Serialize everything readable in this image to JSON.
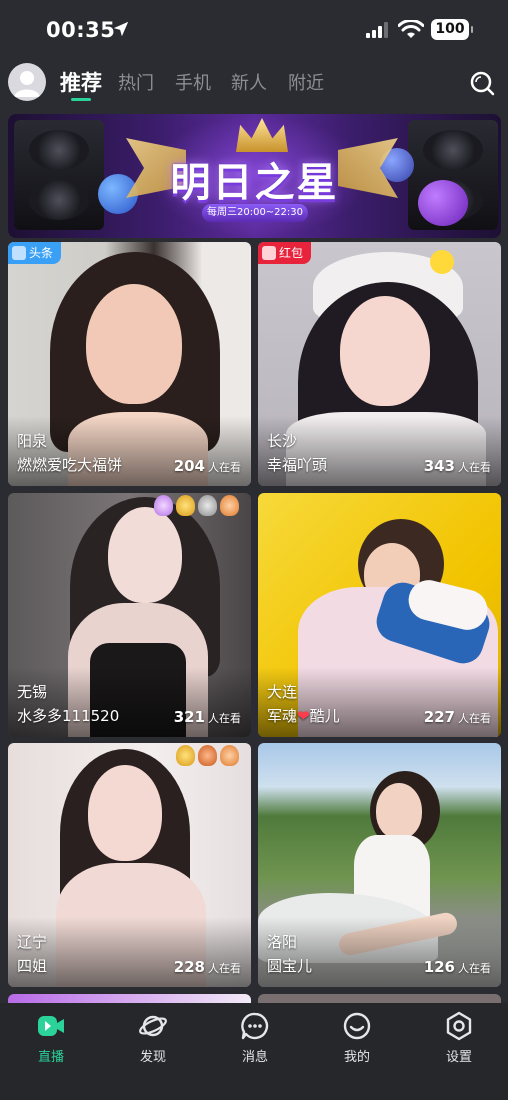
{
  "status_bar": {
    "time": "00:35",
    "battery": "100"
  },
  "top_tabs": [
    {
      "label": "推荐",
      "active": true
    },
    {
      "label": "热门",
      "active": false
    },
    {
      "label": "手机",
      "active": false
    },
    {
      "label": "新人",
      "active": false
    },
    {
      "label": "附近",
      "active": false
    }
  ],
  "banner": {
    "title": "明日之星",
    "subtitle": "每周三20:00~22:30"
  },
  "cards": [
    {
      "tag": "头条",
      "city": "阳泉",
      "nickname": "燃燃爱吃大福饼",
      "viewers": "204",
      "viewers_suffix": "人在看"
    },
    {
      "tag": "红包",
      "city": "长沙",
      "nickname": "幸福吖頭",
      "viewers": "343",
      "viewers_suffix": "人在看"
    },
    {
      "city": "无锡",
      "nickname": "水多多111520",
      "viewers": "321",
      "viewers_suffix": "人在看"
    },
    {
      "city": "大连",
      "nickname_prefix": "军魂",
      "nickname_suffix": "酷儿",
      "viewers": "227",
      "viewers_suffix": "人在看"
    },
    {
      "city": "辽宁",
      "nickname": "四姐",
      "viewers": "228",
      "viewers_suffix": "人在看"
    },
    {
      "city": "洛阳",
      "nickname": "圆宝儿",
      "viewers": "126",
      "viewers_suffix": "人在看"
    }
  ],
  "bottom_nav": [
    {
      "label": "直播",
      "icon": "live-icon",
      "active": true
    },
    {
      "label": "发现",
      "icon": "planet-icon",
      "active": false
    },
    {
      "label": "消息",
      "icon": "message-icon",
      "active": false
    },
    {
      "label": "我的",
      "icon": "profile-smile-icon",
      "active": false
    },
    {
      "label": "设置",
      "icon": "settings-icon",
      "active": false
    }
  ],
  "colors": {
    "accent": "#2bd29a",
    "background": "#2b2c31",
    "tag_headline": "#3aa0f5",
    "tag_redpacket": "#e8233c"
  }
}
